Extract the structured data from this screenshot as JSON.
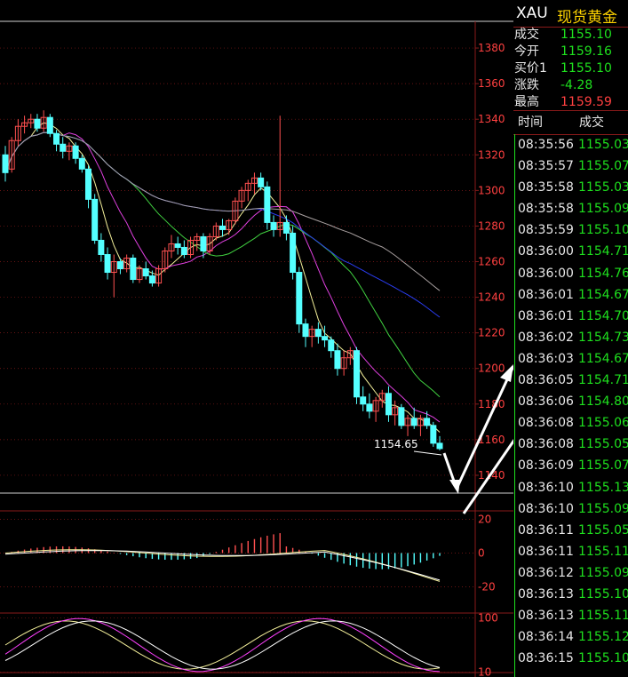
{
  "header": {
    "symbol": "XAU",
    "name": "现货黄金"
  },
  "quote": [
    {
      "label": "成交",
      "value": "1155.10",
      "color": "#1ee01e"
    },
    {
      "label": "今开",
      "value": "1159.16",
      "color": "#1ee01e"
    },
    {
      "label": "买价1",
      "value": "1155.10",
      "color": "#1ee01e"
    },
    {
      "label": "涨跌",
      "value": "-4.28",
      "color": "#1ee01e"
    },
    {
      "label": "最高",
      "value": "1159.59",
      "color": "#ff4040"
    }
  ],
  "ticks_header": {
    "time": "时间",
    "price": "成交"
  },
  "ticks": [
    {
      "time": "08:35:56",
      "price": "1155.03"
    },
    {
      "time": "08:35:57",
      "price": "1155.07"
    },
    {
      "time": "08:35:58",
      "price": "1155.03"
    },
    {
      "time": "08:35:58",
      "price": "1155.09"
    },
    {
      "time": "08:35:59",
      "price": "1155.10"
    },
    {
      "time": "08:36:00",
      "price": "1154.71"
    },
    {
      "time": "08:36:00",
      "price": "1154.76"
    },
    {
      "time": "08:36:01",
      "price": "1154.67"
    },
    {
      "time": "08:36:01",
      "price": "1154.70"
    },
    {
      "time": "08:36:02",
      "price": "1154.73"
    },
    {
      "time": "08:36:03",
      "price": "1154.67"
    },
    {
      "time": "08:36:05",
      "price": "1154.71"
    },
    {
      "time": "08:36:06",
      "price": "1154.80"
    },
    {
      "time": "08:36:08",
      "price": "1155.06"
    },
    {
      "time": "08:36:08",
      "price": "1155.05"
    },
    {
      "time": "08:36:09",
      "price": "1155.07"
    },
    {
      "time": "08:36:10",
      "price": "1155.13"
    },
    {
      "time": "08:36:10",
      "price": "1155.09"
    },
    {
      "time": "08:36:11",
      "price": "1155.05"
    },
    {
      "time": "08:36:11",
      "price": "1155.11"
    },
    {
      "time": "08:36:12",
      "price": "1155.09"
    },
    {
      "time": "08:36:13",
      "price": "1155.10"
    },
    {
      "time": "08:36:13",
      "price": "1155.11"
    },
    {
      "time": "08:36:14",
      "price": "1155.12"
    },
    {
      "time": "08:36:15",
      "price": "1155.10"
    }
  ],
  "chart_data": [
    {
      "type": "candlestick",
      "ylim": [
        1130,
        1395
      ],
      "y_ticks": [
        "1380",
        "1360",
        "1340",
        "1320",
        "1300",
        "1280",
        "1260",
        "1240",
        "1220",
        "1200",
        "1180",
        "1160",
        "1140"
      ],
      "annotation": "1154.65",
      "up_color": "#ff5050",
      "down_color": "#54ffff",
      "candles": [
        [
          1320,
          1325,
          1305,
          1310
        ],
        [
          1312,
          1330,
          1310,
          1328
        ],
        [
          1328,
          1340,
          1325,
          1336
        ],
        [
          1336,
          1342,
          1332,
          1338
        ],
        [
          1338,
          1343,
          1335,
          1340
        ],
        [
          1340,
          1343,
          1333,
          1335
        ],
        [
          1335,
          1345,
          1333,
          1341
        ],
        [
          1341,
          1343,
          1330,
          1332
        ],
        [
          1332,
          1334,
          1322,
          1326
        ],
        [
          1326,
          1330,
          1318,
          1322
        ],
        [
          1322,
          1327,
          1317,
          1325
        ],
        [
          1325,
          1327,
          1315,
          1318
        ],
        [
          1318,
          1320,
          1310,
          1312
        ],
        [
          1312,
          1314,
          1290,
          1295
        ],
        [
          1295,
          1298,
          1270,
          1272
        ],
        [
          1272,
          1276,
          1260,
          1264
        ],
        [
          1264,
          1268,
          1250,
          1254
        ],
        [
          1254,
          1264,
          1240,
          1260
        ],
        [
          1260,
          1262,
          1253,
          1256
        ],
        [
          1256,
          1264,
          1254,
          1262
        ],
        [
          1262,
          1264,
          1248,
          1250
        ],
        [
          1250,
          1258,
          1248,
          1256
        ],
        [
          1256,
          1260,
          1250,
          1252
        ],
        [
          1252,
          1255,
          1246,
          1248
        ],
        [
          1248,
          1258,
          1246,
          1256
        ],
        [
          1256,
          1268,
          1254,
          1266
        ],
        [
          1266,
          1275,
          1262,
          1270
        ],
        [
          1270,
          1274,
          1264,
          1268
        ],
        [
          1268,
          1272,
          1262,
          1264
        ],
        [
          1264,
          1274,
          1262,
          1272
        ],
        [
          1272,
          1276,
          1266,
          1274
        ],
        [
          1274,
          1276,
          1262,
          1266
        ],
        [
          1266,
          1276,
          1264,
          1274
        ],
        [
          1274,
          1282,
          1272,
          1280
        ],
        [
          1280,
          1284,
          1274,
          1278
        ],
        [
          1278,
          1284,
          1275,
          1283
        ],
        [
          1283,
          1296,
          1281,
          1294
        ],
        [
          1294,
          1302,
          1290,
          1300
        ],
        [
          1300,
          1306,
          1294,
          1304
        ],
        [
          1304,
          1310,
          1298,
          1307
        ],
        [
          1307,
          1310,
          1300,
          1302
        ],
        [
          1302,
          1305,
          1278,
          1282
        ],
        [
          1282,
          1286,
          1274,
          1278
        ],
        [
          1278,
          1342,
          1274,
          1282
        ],
        [
          1282,
          1286,
          1272,
          1276
        ],
        [
          1276,
          1280,
          1250,
          1254
        ],
        [
          1254,
          1257,
          1220,
          1225
        ],
        [
          1225,
          1228,
          1212,
          1218
        ],
        [
          1218,
          1224,
          1212,
          1222
        ],
        [
          1222,
          1226,
          1214,
          1218
        ],
        [
          1218,
          1224,
          1212,
          1216
        ],
        [
          1216,
          1218,
          1206,
          1210
        ],
        [
          1210,
          1214,
          1196,
          1200
        ],
        [
          1200,
          1210,
          1196,
          1206
        ],
        [
          1206,
          1212,
          1202,
          1210
        ],
        [
          1210,
          1212,
          1180,
          1184
        ],
        [
          1184,
          1190,
          1176,
          1180
        ],
        [
          1180,
          1186,
          1172,
          1176
        ],
        [
          1176,
          1184,
          1170,
          1182
        ],
        [
          1182,
          1188,
          1178,
          1186
        ],
        [
          1186,
          1190,
          1170,
          1174
        ],
        [
          1174,
          1182,
          1168,
          1178
        ],
        [
          1178,
          1180,
          1166,
          1168
        ],
        [
          1168,
          1174,
          1162,
          1172
        ],
        [
          1172,
          1178,
          1166,
          1168
        ],
        [
          1168,
          1174,
          1162,
          1172
        ],
        [
          1172,
          1176,
          1166,
          1168
        ],
        [
          1168,
          1170,
          1156,
          1158
        ],
        [
          1158,
          1162,
          1154,
          1155
        ]
      ]
    },
    {
      "type": "line+bar",
      "ylim": [
        -25,
        25
      ],
      "y_ticks": [
        "20",
        "0",
        "-20"
      ]
    },
    {
      "type": "line",
      "ylim": [
        5,
        108
      ],
      "y_ticks": [
        "100",
        "10"
      ]
    }
  ]
}
